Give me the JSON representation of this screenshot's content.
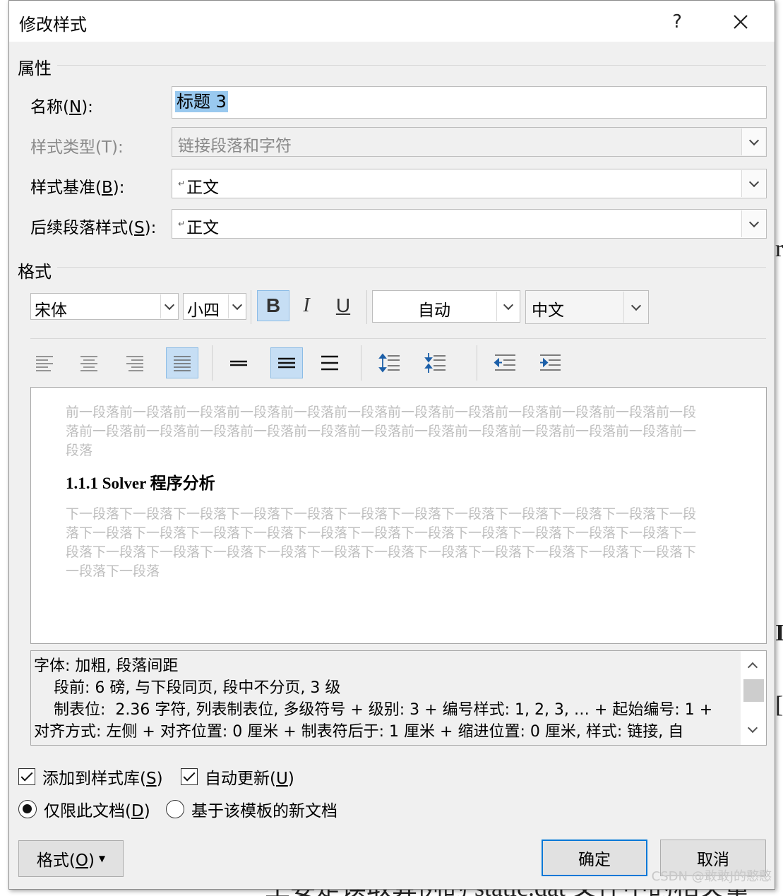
{
  "dialog": {
    "title": "修改样式",
    "help_label": "?",
    "close_label": "✕"
  },
  "properties": {
    "section_label": "属性",
    "name_label": "名称(N):",
    "name_value": "标题 3",
    "style_type_label": "样式类型(T):",
    "style_type_value": "链接段落和字符",
    "based_on_label": "样式基准(B):",
    "based_on_value": "正文",
    "following_label": "后续段落样式(S):",
    "following_value": "正文"
  },
  "format": {
    "section_label": "格式",
    "font_value": "宋体",
    "size_value": "小四",
    "bold_label": "B",
    "italic_label": "I",
    "underline_label": "U",
    "color_value": "自动",
    "script_value": "中文"
  },
  "preview": {
    "before_text": "前一段落前一段落前一段落前一段落前一段落前一段落前一段落前一段落前一段落前一段落前一段落前一段落前一段落前一段落前一段落前一段落前一段落前一段落前一段落前一段落前一段落前一段落前一段落前一段落",
    "heading_text": "1.1.1  Solver 程序分析",
    "after_text": "下一段落下一段落下一段落下一段落下一段落下一段落下一段落下一段落下一段落下一段落下一段落下一段落下一段落下一段落下一段落下一段落下一段落下一段落下一段落下一段落下一段落下一段落下一段落下一段落下一段落下一段落下一段落下一段落下一段落下一段落下一段落下一段落下一段落下一段落下一段落下一段落下一段落"
  },
  "description": {
    "line1": "字体: 加粗, 段落间距",
    "line2": "    段前: 6 磅, 与下段同页, 段中不分页, 3 级",
    "line3": "    制表位:  2.36 字符, 列表制表位, 多级符号 + 级别: 3 + 编号样式: 1, 2, 3, … + 起始编号: 1 +",
    "line4": "对齐方式: 左侧 + 对齐位置:  0 厘米 + 制表符后于:  1 厘米 + 缩进位置:  0 厘米, 样式: 链接, 自"
  },
  "options": {
    "add_to_gallery_label": "添加到样式库(S)",
    "auto_update_label": "自动更新(U)",
    "only_this_doc_label": "仅限此文档(D)",
    "new_docs_label": "基于该模板的新文档"
  },
  "buttons": {
    "format_label": "格式(O)",
    "ok_label": "确定",
    "cancel_label": "取消"
  },
  "background": {
    "right_char_1": "⌐",
    "bottom_text": "主要是读取算例的 static.dat 文件中的相关量"
  },
  "watermark": "CSDN @敢敢J的憨憨"
}
